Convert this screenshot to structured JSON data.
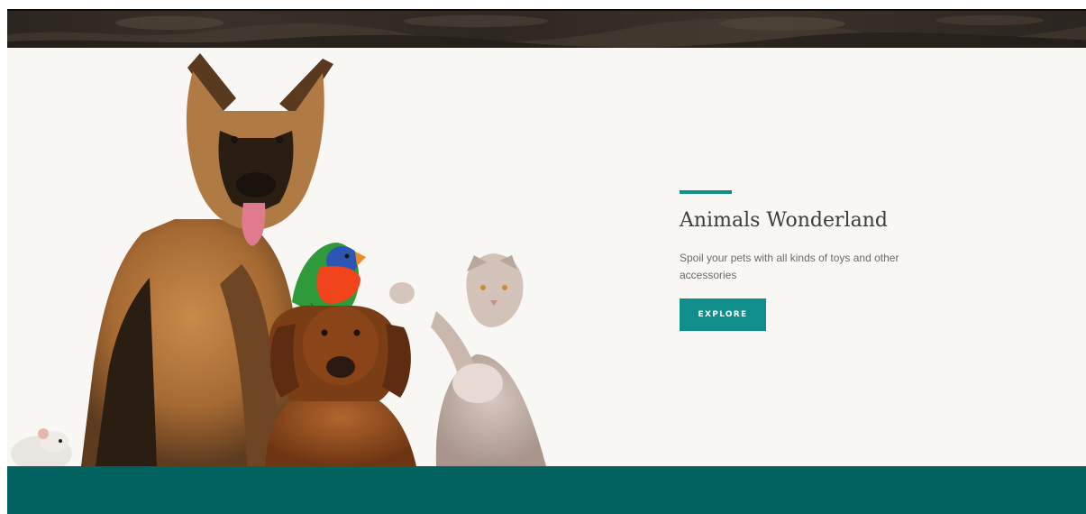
{
  "hero": {
    "title": "Animals Wonderland",
    "description": "Spoil your pets with all kinds of toys and other accessories",
    "button_label": "EXPLORE"
  },
  "colors": {
    "accent": "#0f8e8b",
    "button_bg": "#0f8e8b",
    "footer_band": "#02625f",
    "hero_bg": "#f8f7f4",
    "top_band": "#2f2922"
  },
  "icons": {
    "hero_image": "pets-group-image"
  }
}
